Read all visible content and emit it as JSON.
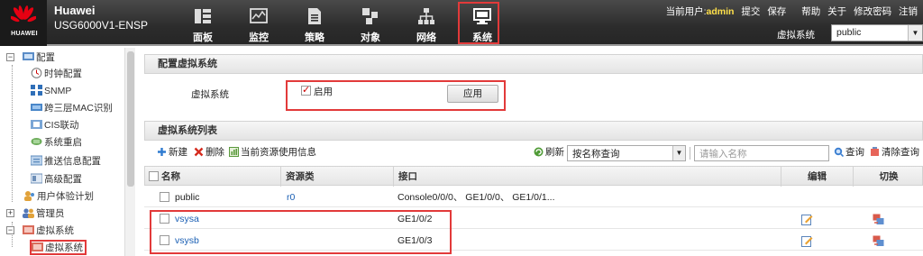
{
  "header": {
    "logo_text": "HUAWEI",
    "brand": "Huawei",
    "model": "USG6000V1-ENSP",
    "nav": [
      {
        "label": "面板",
        "icon": "dashboard-icon"
      },
      {
        "label": "监控",
        "icon": "monitor-icon"
      },
      {
        "label": "策略",
        "icon": "policy-icon"
      },
      {
        "label": "对象",
        "icon": "object-icon"
      },
      {
        "label": "网络",
        "icon": "network-icon"
      },
      {
        "label": "系统",
        "icon": "system-icon",
        "active": true
      }
    ],
    "current_user_label": "当前用户:",
    "current_user": "admin",
    "links": [
      "提交",
      "保存",
      "帮助",
      "关于",
      "修改密码",
      "注销"
    ],
    "vsys_label": "虚拟系统",
    "vsys_value": "public",
    "accent_color": "#e23a3a"
  },
  "tree": {
    "items": [
      {
        "label": "配置",
        "icon": "config-icon",
        "toggle": "−"
      },
      {
        "label": "时钟配置",
        "icon": "clock-icon"
      },
      {
        "label": "SNMP",
        "icon": "snmp-icon"
      },
      {
        "label": "跨三层MAC识别",
        "icon": "mac-icon"
      },
      {
        "label": "CIS联动",
        "icon": "cis-icon"
      },
      {
        "label": "系统重启",
        "icon": "restart-icon"
      },
      {
        "label": "推送信息配置",
        "icon": "push-icon"
      },
      {
        "label": "高级配置",
        "icon": "advanced-icon"
      },
      {
        "label": "用户体验计划",
        "icon": "user-experience-icon"
      },
      {
        "label": "管理员",
        "icon": "admin-icon",
        "toggle": "+"
      },
      {
        "label": "虚拟系统",
        "icon": "vsys-folder-icon",
        "toggle": "−"
      },
      {
        "label": "虚拟系统",
        "icon": "vsys-icon",
        "selected": true
      }
    ]
  },
  "config_panel": {
    "title": "配置虚拟系统",
    "field_label": "虚拟系统",
    "enable_label": "启用",
    "enabled": true,
    "apply_label": "应用"
  },
  "list_panel": {
    "title": "虚拟系统列表",
    "toolbar": {
      "new_label": "新建",
      "delete_label": "删除",
      "resource_label": "当前资源使用信息",
      "refresh_label": "刷新",
      "filter_value": "按名称查询",
      "search_placeholder": "请输入名称",
      "search_label": "查询",
      "clear_label": "清除查询"
    },
    "columns": [
      "名称",
      "资源类",
      "接口",
      "编辑",
      "切换"
    ],
    "rows": [
      {
        "name": "public",
        "resource": "r0",
        "iface": "Console0/0/0、 GE1/0/0、 GE1/0/1...",
        "editable": false
      },
      {
        "name": "vsysa",
        "resource": "",
        "iface": "GE1/0/2",
        "editable": true
      },
      {
        "name": "vsysb",
        "resource": "",
        "iface": "GE1/0/3",
        "editable": true
      }
    ]
  }
}
